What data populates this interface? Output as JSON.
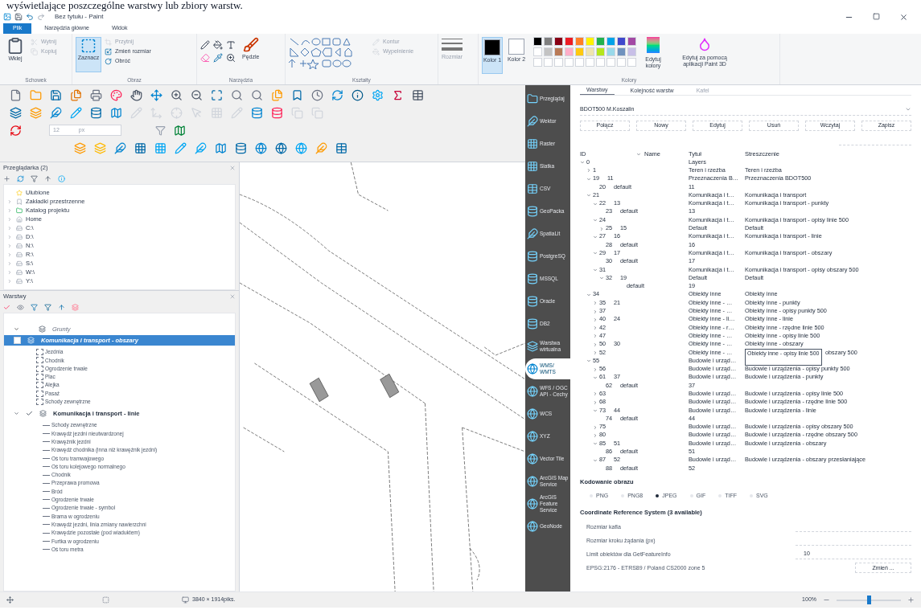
{
  "document_text": "wyświetlające poszczególne warstwy lub zbiory warstw.",
  "window": {
    "title": "Bez tytułu - Paint"
  },
  "ribbon_tabs": [
    {
      "label": "Plik",
      "selected": true
    },
    {
      "label": "Narzędzia główne",
      "selected": false
    },
    {
      "label": "Widok",
      "selected": false
    }
  ],
  "ribbon": {
    "clipboard": {
      "group": "Schowek",
      "paste": "Wklej",
      "items": [
        {
          "label": "Wytnij",
          "disabled": true
        },
        {
          "label": "Kopiuj",
          "disabled": true
        }
      ]
    },
    "image": {
      "group": "Obraz",
      "select": "Zaznacz",
      "items": [
        {
          "label": "Przytnij",
          "disabled": true
        },
        {
          "label": "Zmień rozmiar",
          "disabled": false
        },
        {
          "label": "Obróć",
          "disabled": false
        }
      ]
    },
    "tools": {
      "group": "Narzędzia"
    },
    "brushes": {
      "label": "Pędzle"
    },
    "shapes": {
      "group": "Kształty",
      "items": [
        {
          "label": "Kontur",
          "disabled": true
        },
        {
          "label": "Wypełnienie",
          "disabled": true
        }
      ]
    },
    "size": {
      "label": "Rozmiar",
      "disabled": true
    },
    "active_colors": [
      {
        "label": "Kolor 1",
        "color": "#000000",
        "selected": true
      },
      {
        "label": "Kolor 2",
        "color": "#ffffff",
        "selected": false
      }
    ],
    "palette": [
      {
        "color": "#000000"
      },
      {
        "color": "#7f7f7f"
      },
      {
        "color": "#880015"
      },
      {
        "color": "#ed1c24"
      },
      {
        "color": "#ff7f27"
      },
      {
        "color": "#fff200"
      },
      {
        "color": "#22b14c"
      },
      {
        "color": "#00a2e8"
      },
      {
        "color": "#3f48cc"
      },
      {
        "color": "#a349a4"
      },
      {
        "color": "#ffffff"
      },
      {
        "color": "#c3c3c3"
      },
      {
        "color": "#b97a57"
      },
      {
        "color": "#ffaec9"
      },
      {
        "color": "#ffc90e"
      },
      {
        "color": "#efe4b0"
      },
      {
        "color": "#b5e61d"
      },
      {
        "color": "#99d9ea"
      },
      {
        "color": "#7092be"
      },
      {
        "color": "#c8bfe7"
      }
    ],
    "colors_group": "Kolory",
    "edit_colors": "Edytuj kolory",
    "paint3d": "Edytuj za pomocą aplikacji Paint 3D"
  },
  "toolbar_field": {
    "value": "12",
    "unit": "px"
  },
  "browser_panel": {
    "title": "Przeglądarka (2)",
    "items": [
      {
        "label": "Ulubione"
      },
      {
        "label": "Zakładki przestrzenne",
        "expanded": false
      },
      {
        "label": "Katalog projektu",
        "expanded": false
      },
      {
        "label": "Home",
        "expanded": false
      },
      {
        "label": "C:\\",
        "expanded": false
      },
      {
        "label": "D:\\",
        "expanded": false
      },
      {
        "label": "N:\\",
        "expanded": false
      },
      {
        "label": "R:\\",
        "expanded": false
      },
      {
        "label": "S:\\",
        "expanded": false
      },
      {
        "label": "W:\\",
        "expanded": false
      },
      {
        "label": "Y:\\",
        "expanded": false
      }
    ]
  },
  "layers_panel": {
    "title": "Warstwy",
    "items": [
      {
        "kind": "group",
        "label": "Grunty",
        "expanded": true
      },
      {
        "kind": "area",
        "label": "Komunikacja i transport - obszary",
        "selected": true,
        "checked": false,
        "legend": [
          "Jezdnia",
          "Chodnik",
          "Ogrodzenie trwałe",
          "Plac",
          "Alejka",
          "Pasaż",
          "Schody zewnętrzne"
        ]
      },
      {
        "kind": "line",
        "label": "Komunikacja i transport - linie",
        "selected": false,
        "checked": true,
        "expanded": true,
        "legend": [
          "Schody zewnętrzne",
          "Krawędź jezdni nieutwardzonej",
          "Krawężnik jezdni",
          "Krawędź chodnika (inna niż krawężnik jezdni)",
          "Oś toru tramwajowego",
          "Oś toru kolejowego normalnego",
          "Chodnik",
          "Przeprawa promowa",
          "Bród",
          "Ogrodzenie trwałe",
          "Ogrodzenie trwałe - symbol",
          "Brama w ogrodzeniu",
          "Krawędź jezdni, linia zmiany nawierzchni",
          "Krawędzie pozostałe (pod wiaduktem)",
          "Furtka w ogrodzeniu",
          "Oś toru metra"
        ]
      }
    ]
  },
  "source_sidebar": [
    {
      "label": "Przeglądaj",
      "selected": false
    },
    {
      "label": "Wektor",
      "selected": false
    },
    {
      "label": "Raster",
      "selected": false
    },
    {
      "label": "Siatka",
      "selected": false
    },
    {
      "label": "CSV",
      "selected": false
    },
    {
      "label": "GeoPacka",
      "selected": false
    },
    {
      "label": "SpatiaLit",
      "selected": false
    },
    {
      "label": "PostgreSQ",
      "selected": false
    },
    {
      "label": "MSSQL",
      "selected": false
    },
    {
      "label": "Oracle",
      "selected": false
    },
    {
      "label": "DB2",
      "selected": false
    },
    {
      "label": "Warstwa wirtualna",
      "selected": false
    },
    {
      "label": "WMS/ WMTS",
      "selected": true
    },
    {
      "label": "WFS / OGC API - Cechy",
      "selected": false
    },
    {
      "label": "WCS",
      "selected": false
    },
    {
      "label": "XYZ",
      "selected": false
    },
    {
      "label": "Vector Tile",
      "selected": false
    },
    {
      "label": "ArcGIS Map Service",
      "selected": false
    },
    {
      "label": "ArcGIS Feature Service",
      "selected": false
    },
    {
      "label": "GeoNode",
      "selected": false
    }
  ],
  "wms_panel": {
    "tabs": [
      {
        "label": "Warstwy",
        "selected": true,
        "disabled": false
      },
      {
        "label": "Kolejność warstw",
        "selected": false,
        "disabled": false
      },
      {
        "label": "Kafel",
        "selected": false,
        "disabled": true
      }
    ],
    "connection": "BDOT500 M.Koszalin",
    "buttons": [
      "Połącz",
      "Nowy",
      "Edytuj",
      "Usuń",
      "Wczytaj",
      "Zapisz"
    ],
    "columns": [
      {
        "label": "ID",
        "sorted": false
      },
      {
        "label": "Name",
        "sorted": true
      },
      {
        "label": "Tytuł",
        "sorted": false
      },
      {
        "label": "Streszczenie",
        "sorted": false
      }
    ],
    "rows": [
      {
        "id": "0",
        "title": "Layers",
        "expanded": true,
        "children": [
          {
            "id": "1",
            "title": "Teren i rzeźba",
            "summary": "Teren i rzeźba",
            "expanded": false
          },
          {
            "id": "19",
            "name": "11",
            "title": "Przeznaczenia B…",
            "summary": "Przeznaczenia BDOT500",
            "expanded": true,
            "children": [
              {
                "id": "20",
                "name": "default",
                "title": "11"
              }
            ]
          },
          {
            "id": "21",
            "title": "Komunikacja i t…",
            "summary": "Komunikacja i transport",
            "expanded": true,
            "children": [
              {
                "id": "22",
                "name": "13",
                "title": "Komunikacja i t…",
                "summary": "Komunikacja i transport - punkty",
                "expanded": true,
                "children": [
                  {
                    "id": "23",
                    "name": "default",
                    "title": "13"
                  }
                ]
              },
              {
                "id": "24",
                "title": "Komunikacja i t…",
                "summary": "Komunikacja i transport - opisy linie 500",
                "expanded": true,
                "children": [
                  {
                    "id": "25",
                    "name": "15",
                    "title": "Default",
                    "summary": "Default",
                    "expanded": false
                  }
                ]
              },
              {
                "id": "27",
                "name": "16",
                "title": "Komunikacja i t…",
                "summary": "Komunikacja i transport - linie",
                "expanded": true,
                "children": [
                  {
                    "id": "28",
                    "name": "default",
                    "title": "16"
                  }
                ]
              },
              {
                "id": "29",
                "name": "17",
                "title": "Komunikacja i t…",
                "summary": "Komunikacja i transport - obszary",
                "expanded": true,
                "children": [
                  {
                    "id": "30",
                    "name": "default",
                    "title": "17"
                  }
                ]
              },
              {
                "id": "31",
                "title": "Komunikacja i t…",
                "summary": "Komunikacja i transport - opisy obszary 500",
                "expanded": true,
                "children": [
                  {
                    "id": "32",
                    "name": "19",
                    "title": "Default",
                    "summary": "Default",
                    "expanded": true,
                    "children": [
                      {
                        "name": "default",
                        "title": "19"
                      }
                    ]
                  }
                ]
              }
            ]
          },
          {
            "id": "34",
            "title": "Obiekty inne",
            "summary": "Obiekty inne",
            "expanded": true,
            "children": [
              {
                "id": "35",
                "name": "21",
                "title": "Obiekty inne - …",
                "summary": "Obiekty inne - punkty",
                "expanded": false
              },
              {
                "id": "37",
                "title": "Obiekty inne - …",
                "summary": "Obiekty inne - opisy punkty 500",
                "expanded": false
              },
              {
                "id": "40",
                "name": "24",
                "title": "Obiekty inne - li…",
                "summary": "Obiekty inne - linie",
                "expanded": false
              },
              {
                "id": "42",
                "title": "Obiekty inne - r…",
                "summary": "Obiekty inne - rzędne linie 500",
                "expanded": false
              },
              {
                "id": "47",
                "title": "Obiekty inne - …",
                "summary": "Obiekty inne - opisy linie 500",
                "expanded": false
              },
              {
                "id": "50",
                "name": "30",
                "title": "Obiekty inne - …",
                "summary": "Obiekty inne - obszary",
                "expanded": false
              },
              {
                "id": "52",
                "title": "Obiekty inne - …",
                "summary": "obszary 500",
                "tooltip": "Obiekty inne - opisy linie 500",
                "expanded": false
              }
            ]
          },
          {
            "id": "55",
            "title": "Budowle i urząd…",
            "expanded": true,
            "children": [
              {
                "id": "56",
                "title": "Budowle i urząd…",
                "summary": "Budowle i urządzenia - opisy punkty 500",
                "expanded": false
              },
              {
                "id": "61",
                "name": "37",
                "title": "Budowle i urząd…",
                "summary": "Budowle i urządzenia - punkty",
                "expanded": true,
                "children": [
                  {
                    "id": "62",
                    "name": "default",
                    "title": "37"
                  }
                ]
              },
              {
                "id": "63",
                "title": "Budowle i urząd…",
                "summary": "Budowle i urządzenia - opisy linie 500",
                "expanded": false
              },
              {
                "id": "68",
                "title": "Budowle i urząd…",
                "summary": "Budowle i urządzenia - rzędne linie 500",
                "expanded": false
              },
              {
                "id": "73",
                "name": "44",
                "title": "Budowle i urząd…",
                "summary": "Budowle i urządzenia - linie",
                "expanded": true,
                "children": [
                  {
                    "id": "74",
                    "name": "default",
                    "title": "44"
                  }
                ]
              },
              {
                "id": "75",
                "title": "Budowle i urząd…",
                "summary": "Budowle i urządzenia - opisy obszary 500",
                "expanded": false
              },
              {
                "id": "80",
                "title": "Budowle i urząd…",
                "summary": "Budowle i urządzenia - rzędne obszary 500",
                "expanded": false
              },
              {
                "id": "85",
                "name": "51",
                "title": "Budowle i urząd…",
                "summary": "Budowle i urządzenia - obszary",
                "expanded": true,
                "children": [
                  {
                    "id": "86",
                    "name": "default",
                    "title": "51"
                  }
                ]
              },
              {
                "id": "87",
                "name": "52",
                "title": "Budowle i urząd…",
                "summary": "Budowle i urządzenia - obszary przesłaniające",
                "expanded": true,
                "children": [
                  {
                    "id": "88",
                    "name": "default",
                    "title": "52"
                  }
                ]
              }
            ]
          }
        ]
      }
    ],
    "encoding": {
      "title": "Kodowanie obrazu",
      "options": [
        {
          "label": "PNG",
          "selected": false
        },
        {
          "label": "PNG8",
          "selected": false
        },
        {
          "label": "JPEG",
          "selected": true
        },
        {
          "label": "GIF",
          "selected": false
        },
        {
          "label": "TIFF",
          "selected": false
        },
        {
          "label": "SVG",
          "selected": false
        }
      ]
    },
    "crs_title": "Coordinate Reference System (3 available)",
    "fields": [
      {
        "label": "Rozmiar kafla"
      },
      {
        "label": "Rozmiar kroku żądania (px)"
      },
      {
        "label": "Limit obiektów dla GetFeatureInfo",
        "value": "10"
      }
    ],
    "crs": {
      "label": "EPSG:2176 - ETRS89 / Poland CS2000 zone 5",
      "button": "Zmień ..."
    }
  },
  "status_bar": {
    "canvas_size": "3840 × 1914piks.",
    "zoom": "100%",
    "zoom_slider": {
      "level": 0.5
    }
  }
}
